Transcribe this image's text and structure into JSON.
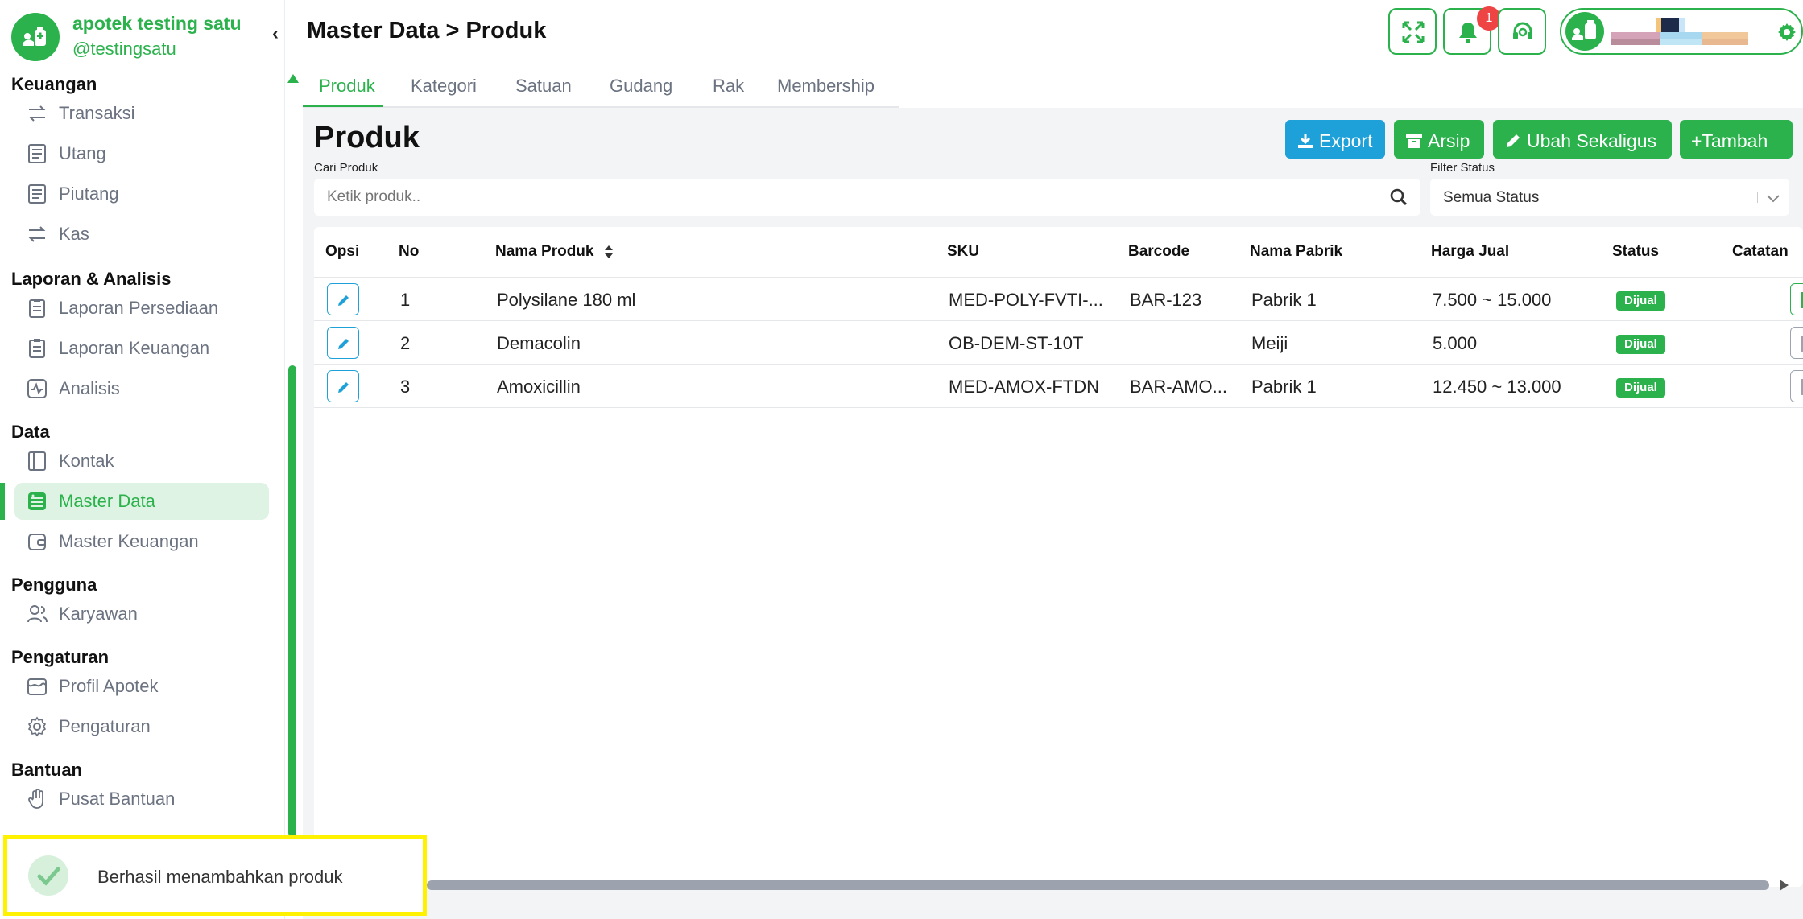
{
  "brand": {
    "name": "apotek testing satu",
    "handle": "@testingsatu"
  },
  "menu": {
    "sections": [
      {
        "title": "Keuangan",
        "items": [
          "Transaksi",
          "Utang",
          "Piutang",
          "Kas"
        ]
      },
      {
        "title": "Laporan & Analisis",
        "items": [
          "Laporan Persediaan",
          "Laporan Keuangan",
          "Analisis"
        ]
      },
      {
        "title": "Data",
        "items": [
          "Kontak",
          "Master Data",
          "Master Keuangan"
        ]
      },
      {
        "title": "Pengguna",
        "items": [
          "Karyawan"
        ]
      },
      {
        "title": "Pengaturan",
        "items": [
          "Profil Apotek",
          "Pengaturan"
        ]
      },
      {
        "title": "Bantuan",
        "items": [
          "Pusat Bantuan"
        ]
      }
    ],
    "active_item": "Master Data"
  },
  "header": {
    "breadcrumb": "Master Data > Produk",
    "notification_count": "1",
    "icons": [
      "fullscreen-icon",
      "bell-icon",
      "headset-icon",
      "gear-icon"
    ]
  },
  "tabs": [
    "Produk",
    "Kategori",
    "Satuan",
    "Gudang",
    "Rak",
    "Membership"
  ],
  "active_tab": "Produk",
  "page": {
    "title": "Produk",
    "buttons": {
      "export": "Export",
      "archive": "Arsip",
      "bulk_edit": "Ubah Sekaligus",
      "add": "+Tambah"
    },
    "search_label": "Cari Produk",
    "search_placeholder": "Ketik produk..",
    "search_value": "",
    "filter_label": "Filter Status",
    "filter_value": "Semua Status"
  },
  "table": {
    "columns": [
      "Opsi",
      "No",
      "Nama Produk",
      "SKU",
      "Barcode",
      "Nama Pabrik",
      "Harga Jual",
      "Status",
      "Catatan"
    ],
    "rows": [
      {
        "no": "1",
        "name": "Polysilane 180 ml",
        "sku": "MED-POLY-FVTI-...",
        "barcode": "BAR-123",
        "factory": "Pabrik 1",
        "price": "7.500 ~ 15.000",
        "status": "Dijual",
        "has_note": true
      },
      {
        "no": "2",
        "name": "Demacolin",
        "sku": "OB-DEM-ST-10T",
        "barcode": "",
        "factory": "Meiji",
        "price": "5.000",
        "status": "Dijual",
        "has_note": false
      },
      {
        "no": "3",
        "name": "Amoxicillin",
        "sku": "MED-AMOX-FTDN",
        "barcode": "BAR-AMO...",
        "factory": "Pabrik 1",
        "price": "12.450 ~ 13.000",
        "status": "Dijual",
        "has_note": false
      }
    ]
  },
  "toast": {
    "message": "Berhasil menambahkan produk"
  },
  "colors": {
    "primary": "#2bb24c",
    "export": "#1ea1d9",
    "badge": "#2bb24c",
    "toast_border": "#fff200"
  }
}
